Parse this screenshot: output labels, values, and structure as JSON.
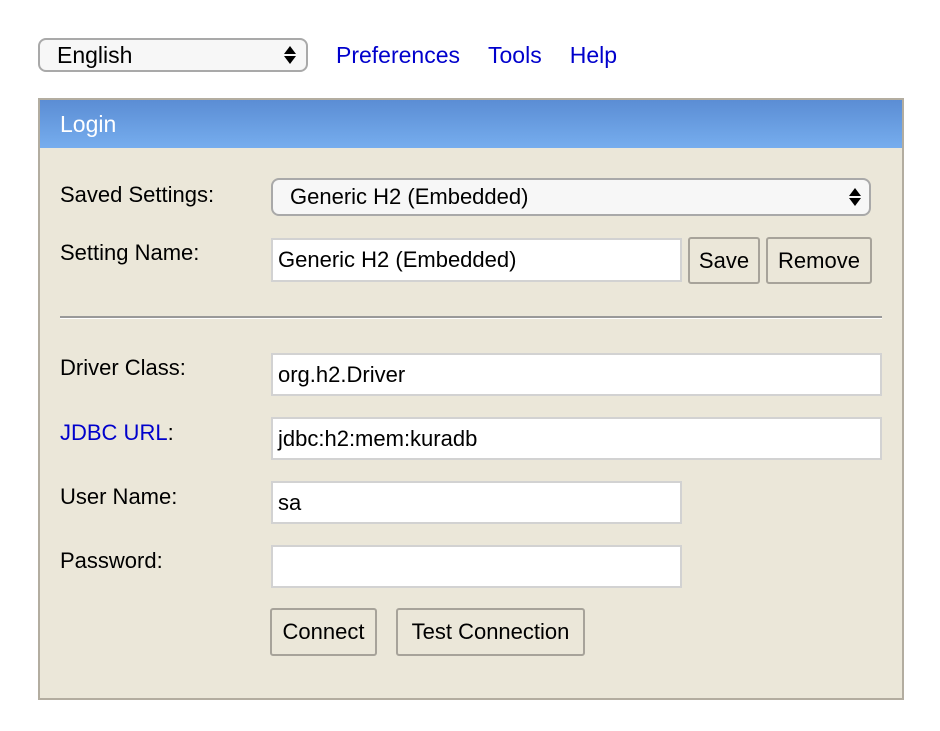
{
  "topbar": {
    "language": "English",
    "links": [
      "Preferences",
      "Tools",
      "Help"
    ]
  },
  "login": {
    "title": "Login",
    "saved_settings_label": "Saved Settings:",
    "saved_settings_value": "Generic H2 (Embedded)",
    "setting_name_label": "Setting Name:",
    "setting_name_value": "Generic H2 (Embedded)",
    "save_label": "Save",
    "remove_label": "Remove",
    "driver_class_label": "Driver Class:",
    "driver_class_value": "org.h2.Driver",
    "jdbc_url_link": "JDBC URL",
    "jdbc_url_colon": ":",
    "jdbc_url_value": "jdbc:h2:mem:kuradb",
    "user_name_label": "User Name:",
    "user_name_value": "sa",
    "password_label": "Password:",
    "password_value": "",
    "connect_label": "Connect",
    "test_connection_label": "Test Connection"
  },
  "colors": {
    "header_gradient_top": "#5b8dd4",
    "header_gradient_bottom": "#76adee",
    "panel_background": "#ebe7d9",
    "link": "#0000cc"
  }
}
